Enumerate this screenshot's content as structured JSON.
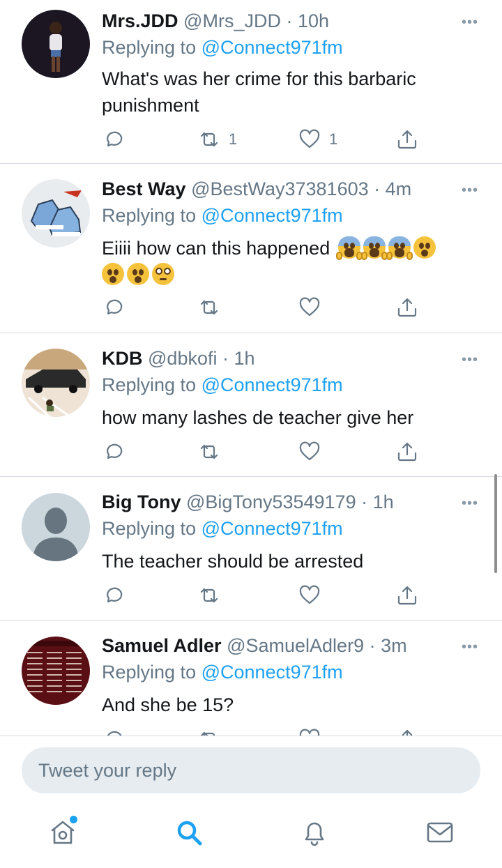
{
  "tweets": [
    {
      "name": "Mrs.JDD",
      "handle": "@Mrs_JDD",
      "time": "10h",
      "replying_label": "Replying to",
      "replying_to": "@Connect971fm",
      "text": "What's was her crime for this barbaric punishment",
      "retweets": "1",
      "likes": "1"
    },
    {
      "name": "Best Way",
      "handle": "@BestWay37381603",
      "time": "4m",
      "replying_label": "Replying to",
      "replying_to": "@Connect971fm",
      "text": "Eiiii how can this happened",
      "retweets": "",
      "likes": ""
    },
    {
      "name": "KDB",
      "handle": "@dbkofi",
      "time": "1h",
      "replying_label": "Replying to",
      "replying_to": "@Connect971fm",
      "text": "how many lashes de teacher give her",
      "retweets": "",
      "likes": ""
    },
    {
      "name": "Big Tony",
      "handle": "@BigTony53549179",
      "time": "1h",
      "replying_label": "Replying to",
      "replying_to": "@Connect971fm",
      "text": "The teacher should be arrested",
      "retweets": "",
      "likes": ""
    },
    {
      "name": "Samuel Adler",
      "handle": "@SamuelAdler9",
      "time": "3m",
      "replying_label": "Replying to",
      "replying_to": "@Connect971fm",
      "text": "And she be 15?",
      "retweets": "",
      "likes": ""
    }
  ],
  "composer": {
    "placeholder": "Tweet your reply"
  },
  "icons": {
    "more": "more-icon",
    "reply": "reply-icon",
    "retweet": "retweet-icon",
    "like": "heart-icon",
    "share": "share-icon",
    "home": "home-icon",
    "search": "search-icon",
    "notifications": "bell-icon",
    "messages": "mail-icon"
  },
  "colors": {
    "accent": "#1da1f2",
    "secondary_text": "#657786",
    "divider": "#d6dbe0",
    "input_bg": "#e6ecf0"
  },
  "separator": "·",
  "more_glyph": "•••"
}
